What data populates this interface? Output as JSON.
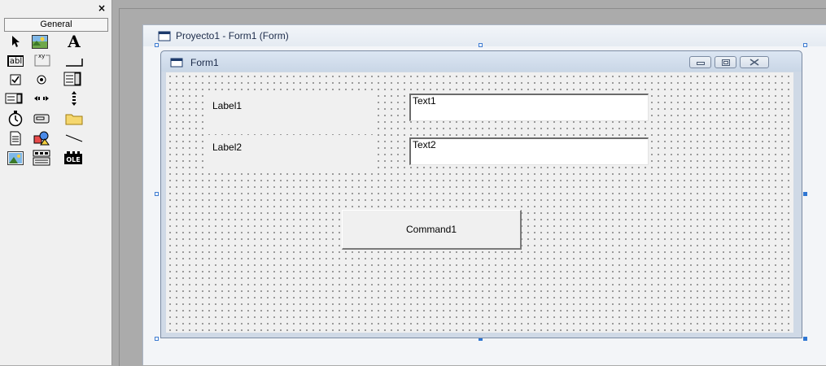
{
  "toolbox": {
    "close_label": "×",
    "tab_label": "General",
    "tools": [
      {
        "name": "pointer-icon",
        "interactable": true
      },
      {
        "name": "picturebox-icon",
        "interactable": true
      },
      {
        "name": "label-icon",
        "glyph": "A",
        "interactable": true
      },
      {
        "name": "textbox-icon",
        "glyph": "abl",
        "interactable": true
      },
      {
        "name": "frame-icon",
        "glyph": "xy",
        "interactable": true
      },
      {
        "name": "commandbutton-icon",
        "interactable": true
      },
      {
        "name": "checkbox-icon",
        "interactable": true
      },
      {
        "name": "optionbutton-icon",
        "interactable": true
      },
      {
        "name": "combobox-icon",
        "interactable": true
      },
      {
        "name": "listbox-icon",
        "interactable": true
      },
      {
        "name": "hscrollbar-icon",
        "interactable": true
      },
      {
        "name": "vscrollbar-icon",
        "interactable": true
      },
      {
        "name": "timer-icon",
        "interactable": true
      },
      {
        "name": "drivelistbox-icon",
        "interactable": true
      },
      {
        "name": "dirlistbox-icon",
        "interactable": true
      },
      {
        "name": "filelistbox-icon",
        "interactable": true
      },
      {
        "name": "shape-icon",
        "interactable": true
      },
      {
        "name": "line-icon",
        "interactable": true
      },
      {
        "name": "image-icon",
        "interactable": true
      },
      {
        "name": "data-icon",
        "interactable": true
      },
      {
        "name": "ole-icon",
        "glyph": "OLE",
        "interactable": true
      }
    ]
  },
  "designer": {
    "window_title": "Proyecto1 - Form1 (Form)"
  },
  "form": {
    "title": "Form1",
    "label1": "Label1",
    "label2": "Label2",
    "text1": "Text1",
    "text2": "Text2",
    "command1": "Command1"
  },
  "colors": {
    "selection_handle": "#2f76d2",
    "form_frame": "#cfd9e6",
    "workspace": "#ababab"
  }
}
